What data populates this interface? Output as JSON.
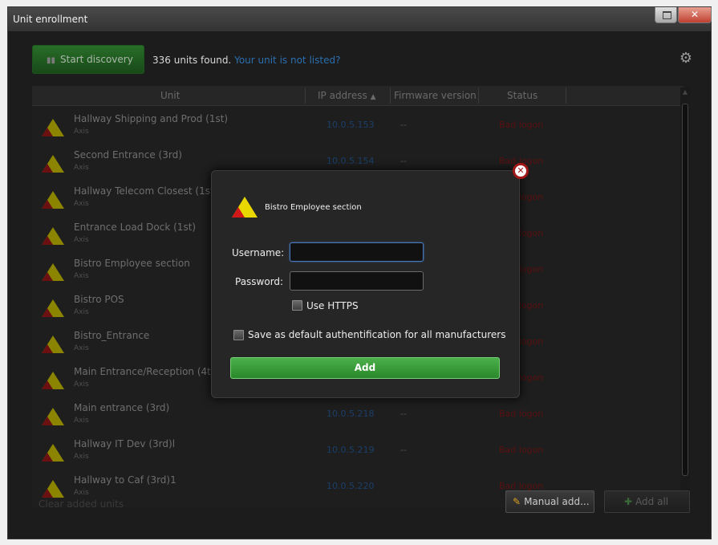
{
  "window": {
    "title": "Unit enrollment",
    "close_glyph": "✕"
  },
  "toolbar": {
    "discovery_label": "Start discovery",
    "found_text": "336 units found.",
    "not_listed_link": "Your unit is not listed?"
  },
  "table": {
    "headers": {
      "unit": "Unit",
      "ip": "IP address",
      "firmware": "Firmware version",
      "status": "Status"
    },
    "sort_indicator": "▲",
    "rows": [
      {
        "name": "Hallway Shipping and Prod (1st)",
        "maker": "Axis",
        "ip": "10.0.5.153",
        "firmware": "--",
        "status": "Bad logon"
      },
      {
        "name": "Second Entrance (3rd)",
        "maker": "Axis",
        "ip": "10.0.5.154",
        "firmware": "--",
        "status": "Bad logon"
      },
      {
        "name": "Hallway Telecom Closest (1st)",
        "maker": "Axis",
        "ip": "",
        "firmware": "",
        "status": "Bad logon"
      },
      {
        "name": "Entrance Load Dock (1st)",
        "maker": "Axis",
        "ip": "",
        "firmware": "",
        "status": "Bad logon"
      },
      {
        "name": "Bistro Employee section",
        "maker": "Axis",
        "ip": "",
        "firmware": "",
        "status": "Bad logon"
      },
      {
        "name": "Bistro POS",
        "maker": "Axis",
        "ip": "",
        "firmware": "",
        "status": "Bad logon"
      },
      {
        "name": "Bistro_Entrance",
        "maker": "Axis",
        "ip": "",
        "firmware": "",
        "status": "Bad logon"
      },
      {
        "name": "Main Entrance/Reception (4th)",
        "maker": "Axis",
        "ip": "",
        "firmware": "",
        "status": "Bad logon"
      },
      {
        "name": "Main entrance (3rd)",
        "maker": "Axis",
        "ip": "10.0.5.218",
        "firmware": "--",
        "status": "Bad logon"
      },
      {
        "name": "Hallway IT Dev (3rd)l",
        "maker": "Axis",
        "ip": "10.0.5.219",
        "firmware": "--",
        "status": "Bad logon"
      },
      {
        "name": "Hallway to Caf (3rd)1",
        "maker": "Axis",
        "ip": "10.0.5.220",
        "firmware": "",
        "status": "Bad logon"
      }
    ]
  },
  "footer": {
    "clear_link": "Clear added units",
    "manual_add_label": "Manual add...",
    "add_all_label": "Add all"
  },
  "dialog": {
    "unit_name": "Bistro Employee section",
    "username_label": "Username:",
    "username_value": "",
    "password_label": "Password:",
    "password_value": "",
    "https_label": "Use HTTPS",
    "https_checked": false,
    "default_auth_label": "Save as default authentification for all manufacturers",
    "default_auth_checked": false,
    "add_label": "Add"
  },
  "icons": {
    "axis_logo": "axis-logo-icon",
    "gear": "gear-icon",
    "close": "close-icon",
    "pencil": "pencil-icon",
    "plus": "plus-icon",
    "binoculars": "binoculars-icon"
  },
  "colors": {
    "accent_green": "#2e9a2e",
    "link_blue": "#2b6fb0",
    "status_red": "#8a1414",
    "axis_yellow": "#e8d800",
    "axis_red": "#d01818"
  }
}
